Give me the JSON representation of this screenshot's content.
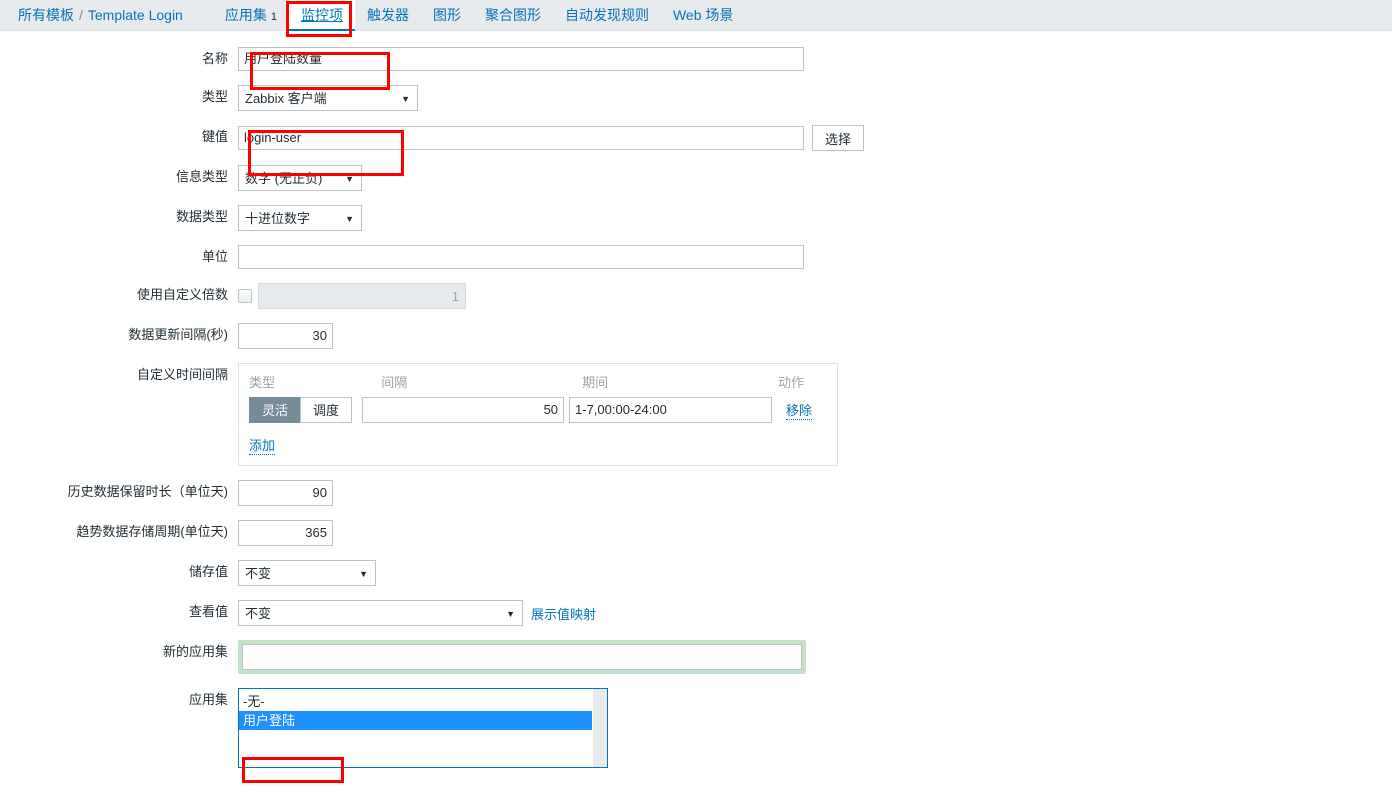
{
  "header": {
    "breadcrumb": {
      "root": "所有模板",
      "separator": "/",
      "template": "Template Login"
    },
    "tabs": [
      {
        "label": "应用集",
        "count": "1",
        "active": false
      },
      {
        "label": "监控项",
        "count": "",
        "active": true
      },
      {
        "label": "触发器",
        "count": "",
        "active": false
      },
      {
        "label": "图形",
        "count": "",
        "active": false
      },
      {
        "label": "聚合图形",
        "count": "",
        "active": false
      },
      {
        "label": "自动发现规则",
        "count": "",
        "active": false
      },
      {
        "label": "Web 场景",
        "count": "",
        "active": false
      }
    ]
  },
  "form": {
    "name": {
      "label": "名称",
      "value": "用户登陆数量",
      "placeholder": ""
    },
    "type": {
      "label": "类型",
      "value": "Zabbix 客户端"
    },
    "key": {
      "label": "键值",
      "value": "login-user",
      "placeholder": "",
      "select_button": "选择"
    },
    "value_type": {
      "label": "信息类型",
      "value": "数字 (无正负)"
    },
    "data_type": {
      "label": "数据类型",
      "value": "十进位数字"
    },
    "units": {
      "label": "单位",
      "value": "",
      "placeholder": ""
    },
    "multiplier": {
      "label": "使用自定义倍数",
      "checked": false,
      "value": "1"
    },
    "update_interval": {
      "label": "数据更新间隔(秒)",
      "value": "30"
    },
    "custom_intervals": {
      "label": "自定义时间间隔",
      "columns": {
        "type": "类型",
        "interval": "间隔",
        "period": "期间",
        "action": "动作"
      },
      "rows": [
        {
          "type_flexible": "灵活",
          "type_scheduling": "调度",
          "selected_type": "灵活",
          "interval": "50",
          "period": "1-7,00:00-24:00",
          "remove": "移除"
        }
      ],
      "add_label": "添加"
    },
    "history": {
      "label": "历史数据保留时长（单位天)",
      "value": "90"
    },
    "trends": {
      "label": "趋势数据存储周期(单位天)",
      "value": "365"
    },
    "store_value": {
      "label": "储存值",
      "value": "不变"
    },
    "show_value": {
      "label": "查看值",
      "value": "不变",
      "mapping_link": "展示值映射"
    },
    "new_application": {
      "label": "新的应用集",
      "value": "",
      "placeholder": ""
    },
    "applications": {
      "label": "应用集",
      "options": [
        {
          "label": "-无-",
          "selected": false
        },
        {
          "label": "用户登陆",
          "selected": true
        }
      ]
    }
  },
  "annotations": {
    "color": "#ff0000",
    "targets": [
      "tab-监控项",
      "name-field",
      "key-field",
      "application-option-用户登陆"
    ]
  }
}
